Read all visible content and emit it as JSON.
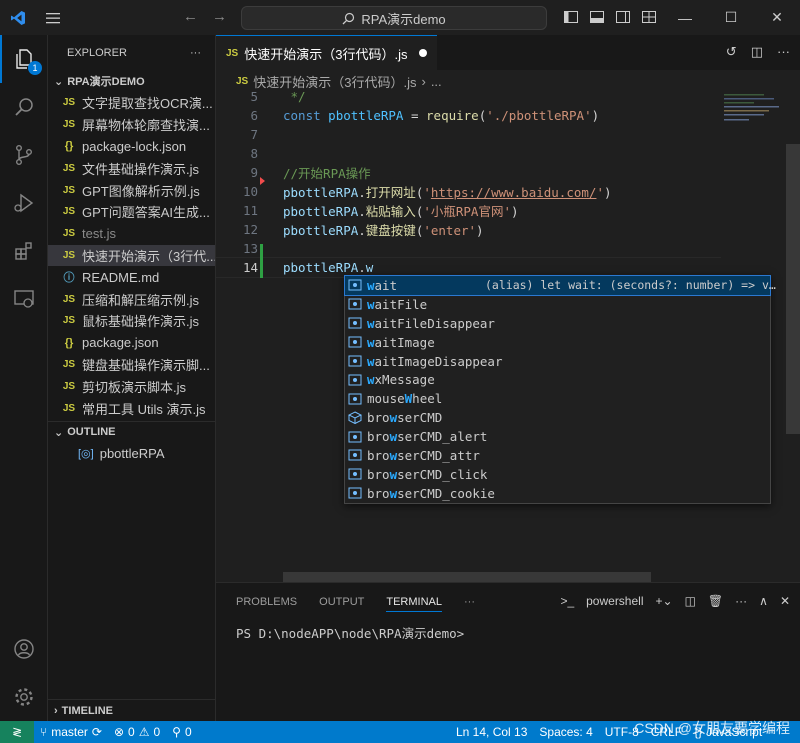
{
  "titlebar": {
    "search_text": "RPA演示demo"
  },
  "activity": {
    "badge": "1"
  },
  "sidebar": {
    "header": "EXPLORER",
    "folder": "RPA演示DEMO",
    "files": [
      {
        "icon": "JS",
        "kind": "js",
        "name": "文字提取查找OCR演..."
      },
      {
        "icon": "JS",
        "kind": "js",
        "name": "屏幕物体轮廓查找演..."
      },
      {
        "icon": "{}",
        "kind": "json",
        "name": "package-lock.json"
      },
      {
        "icon": "JS",
        "kind": "js",
        "name": "文件基础操作演示.js"
      },
      {
        "icon": "JS",
        "kind": "js",
        "name": "GPT图像解析示例.js"
      },
      {
        "icon": "JS",
        "kind": "js",
        "name": "GPT问题答案AI生成..."
      },
      {
        "icon": "JS",
        "kind": "js",
        "name": "test.js"
      },
      {
        "icon": "JS",
        "kind": "js",
        "name": "快速开始演示（3行代..."
      },
      {
        "icon": "ⓘ",
        "kind": "md",
        "name": "README.md"
      },
      {
        "icon": "JS",
        "kind": "js",
        "name": "压缩和解压缩示例.js"
      },
      {
        "icon": "JS",
        "kind": "js",
        "name": "鼠标基础操作演示.js"
      },
      {
        "icon": "{}",
        "kind": "json",
        "name": "package.json"
      },
      {
        "icon": "JS",
        "kind": "js",
        "name": "键盘基础操作演示脚..."
      },
      {
        "icon": "JS",
        "kind": "js",
        "name": "剪切板演示脚本.js"
      },
      {
        "icon": "JS",
        "kind": "js",
        "name": "常用工具 Utils 演示.js"
      }
    ],
    "outline_header": "OUTLINE",
    "outline_item": "pbottleRPA",
    "timeline_header": "TIMELINE"
  },
  "editor": {
    "tab_icon": "JS",
    "tab_label": "快速开始演示（3行代码）.js",
    "breadcrumb_icon": "JS",
    "breadcrumb_file": "快速开始演示（3行代码）.js",
    "breadcrumb_more": "...",
    "lines": {
      "l5": {
        "num": "5",
        "text": " */"
      },
      "l6": {
        "num": "6",
        "kw": "const",
        "var": " pbottleRPA",
        "op": " = ",
        "fn": "require",
        "p1": "(",
        "str": "'./pbottleRPA'",
        "p2": ")"
      },
      "l7": {
        "num": "7"
      },
      "l8": {
        "num": "8"
      },
      "l9": {
        "num": "9",
        "text": "//开始RPA操作"
      },
      "l10": {
        "num": "10",
        "obj": "pbottleRPA",
        "dot": ".",
        "fn": "打开网址",
        "p1": "(",
        "q1": "'",
        "url": "https://www.baidu.com/",
        "q2": "'",
        "p2": ")"
      },
      "l11": {
        "num": "11",
        "obj": "pbottleRPA",
        "dot": ".",
        "fn": "粘贴输入",
        "p1": "(",
        "str": "'小瓶RPA官网'",
        "p2": ")"
      },
      "l12": {
        "num": "12",
        "obj": "pbottleRPA",
        "dot": ".",
        "fn": "键盘按键",
        "p1": "(",
        "str": "'enter'",
        "p2": ")"
      },
      "l13": {
        "num": "13"
      },
      "l14": {
        "num": "14",
        "obj": "pbottleRPA",
        "dot": ".",
        "typed": "w"
      }
    }
  },
  "suggest": {
    "items": [
      {
        "hl": "w",
        "rest": "ait",
        "pre": "",
        "kind": "field"
      },
      {
        "hl": "w",
        "rest": "aitFile",
        "pre": "",
        "kind": "field"
      },
      {
        "hl": "w",
        "rest": "aitFileDisappear",
        "pre": "",
        "kind": "field"
      },
      {
        "hl": "w",
        "rest": "aitImage",
        "pre": "",
        "kind": "field"
      },
      {
        "hl": "w",
        "rest": "aitImageDisappear",
        "pre": "",
        "kind": "field"
      },
      {
        "hl": "w",
        "rest": "xMessage",
        "pre": "",
        "kind": "field"
      },
      {
        "hl": "W",
        "rest": "heel",
        "pre": "mouse",
        "kind": "field"
      },
      {
        "hl": "w",
        "rest": "serCMD",
        "pre": "bro",
        "kind": "module"
      },
      {
        "hl": "w",
        "rest": "serCMD_alert",
        "pre": "bro",
        "kind": "field"
      },
      {
        "hl": "w",
        "rest": "serCMD_attr",
        "pre": "bro",
        "kind": "field"
      },
      {
        "hl": "w",
        "rest": "serCMD_click",
        "pre": "bro",
        "kind": "field"
      },
      {
        "hl": "w",
        "rest": "serCMD_cookie",
        "pre": "bro",
        "kind": "field"
      }
    ],
    "detail": "(alias) let wait: (seconds?: number) => v…"
  },
  "panel": {
    "tabs": [
      "PROBLEMS",
      "OUTPUT",
      "TERMINAL"
    ],
    "more": "···",
    "shell_label": "powershell",
    "prompt": "PS D:\\nodeAPP\\node\\RPA演示demo>"
  },
  "statusbar": {
    "branch": "master",
    "errors": "0",
    "warnings": "0",
    "ports": "0",
    "position": "Ln 14, Col 13",
    "spaces": "Spaces: 4",
    "encoding": "UTF-8",
    "eol": "CRLF",
    "language": "JavaScript",
    "watermark": "CSDN @女朋友要学编程"
  },
  "colors": {
    "accent": "#0078d4",
    "statusbar": "#007acc",
    "remote": "#16825d"
  }
}
